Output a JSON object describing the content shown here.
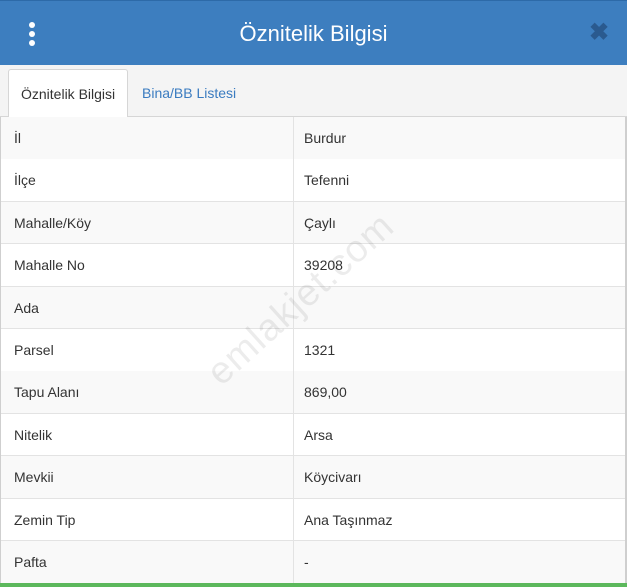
{
  "header": {
    "title": "Öznitelik Bilgisi",
    "close_label": "✖"
  },
  "tabs": [
    {
      "label": "Öznitelik Bilgisi",
      "active": true
    },
    {
      "label": "Bina/BB Listesi",
      "active": false
    }
  ],
  "rows": [
    {
      "label": "İl",
      "value": "Burdur"
    },
    {
      "label": "İlçe",
      "value": "Tefenni"
    },
    {
      "label": "Mahalle/Köy",
      "value": "Çaylı"
    },
    {
      "label": "Mahalle No",
      "value": "39208"
    },
    {
      "label": "Ada",
      "value": ""
    },
    {
      "label": "Parsel",
      "value": "1321"
    },
    {
      "label": "Tapu Alanı",
      "value": "869,00"
    },
    {
      "label": "Nitelik",
      "value": "Arsa"
    },
    {
      "label": "Mevkii",
      "value": "Köycivarı"
    },
    {
      "label": "Zemin Tip",
      "value": "Ana Taşınmaz"
    },
    {
      "label": "Pafta",
      "value": "-"
    }
  ],
  "watermark": "emlakjet.com",
  "colors": {
    "header": "#3d7ebf",
    "tab_link": "#3a7bc0",
    "bottom_accent": "#5cb85c"
  },
  "icons": {
    "menu": "vertical-dots-icon",
    "close": "close-icon"
  }
}
